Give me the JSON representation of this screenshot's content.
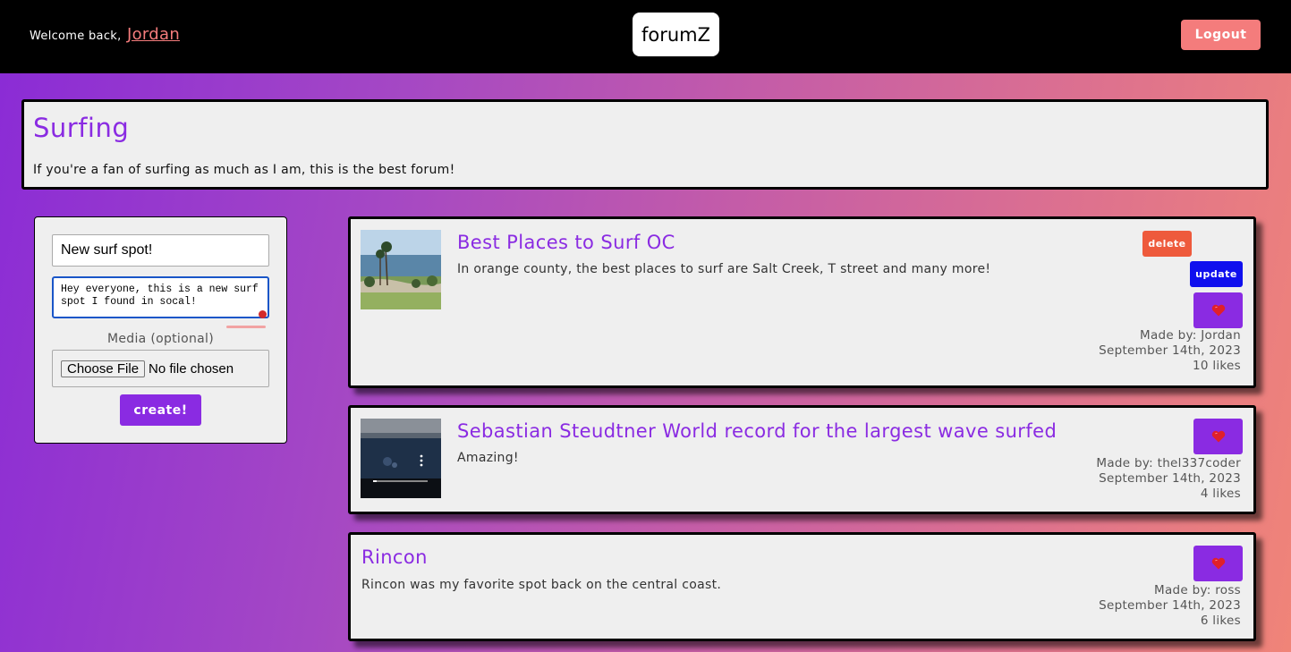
{
  "header": {
    "welcome_text": "Welcome back,",
    "username": "Jordan",
    "logo": "forumZ",
    "logout_label": "Logout"
  },
  "forum": {
    "title": "Surfing",
    "description": "If you're a fan of surfing as much as I am, this is the best forum!"
  },
  "create_form": {
    "title_value": "New surf spot!",
    "body_value": "Hey everyone, this is a new surf spot I found in socal!",
    "media_label": "Media (optional)",
    "choose_file_label": "Choose File",
    "no_file_text": "No file chosen",
    "create_label": "create!"
  },
  "posts": [
    {
      "title": "Best Places to Surf OC",
      "body": "In orange county, the best places to surf are Salt Creek, T street and many more!",
      "author": "Made by: Jordan",
      "date": "September 14th, 2023",
      "likes": "10 likes",
      "delete_label": "delete",
      "update_label": "update",
      "like_icon": "heart-icon"
    },
    {
      "title": "Sebastian Steudtner World record for the largest wave surfed",
      "body": "Amazing!",
      "author": "Made by: thel337coder",
      "date": "September 14th, 2023",
      "likes": "4 likes",
      "like_icon": "heart-icon"
    },
    {
      "title": "Rincon",
      "body": "Rincon was my favorite spot back on the central coast.",
      "author": "Made by: ross",
      "date": "September 14th, 2023",
      "likes": "6 likes",
      "like_icon": "heart-icon"
    }
  ],
  "colors": {
    "accent": "#8a2be2",
    "logout": "#f47c7c",
    "delete": "#ee5a3c",
    "update": "#1010ee"
  }
}
